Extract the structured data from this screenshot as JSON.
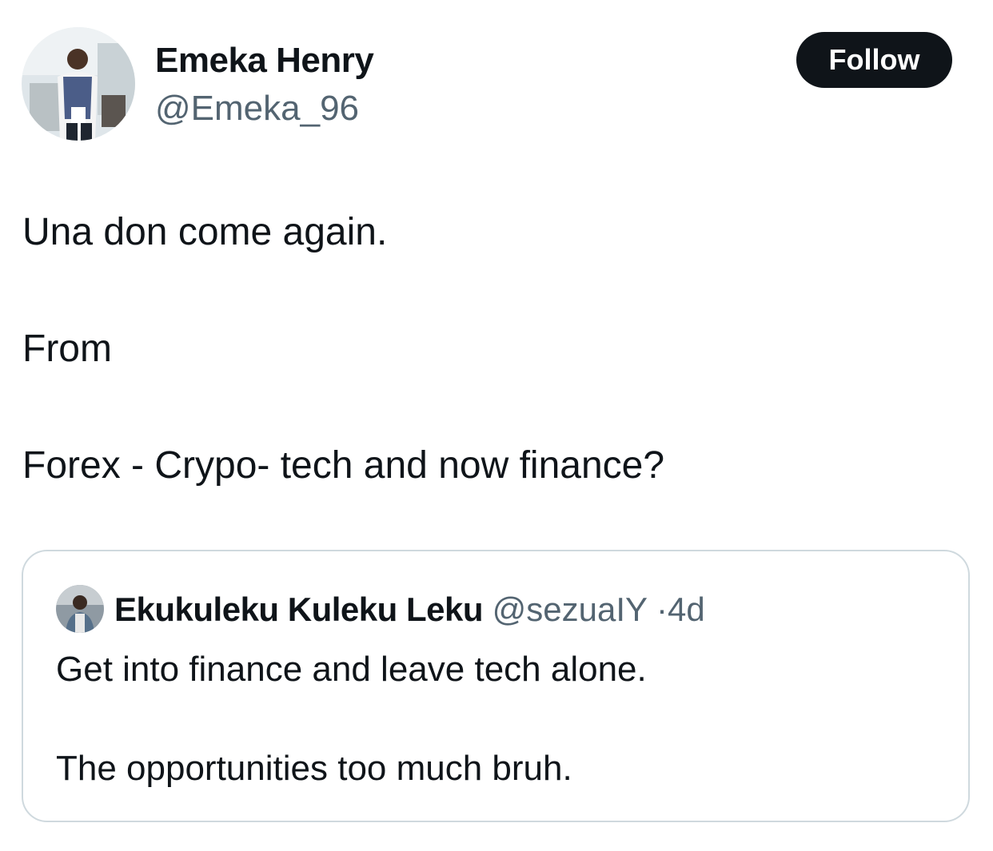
{
  "author": {
    "display_name": "Emeka Henry",
    "handle": "@Emeka_96",
    "avatar_icon": "profile-photo"
  },
  "follow_button": {
    "label": "Follow",
    "background": "#0f1419",
    "text_color": "#ffffff"
  },
  "tweet": {
    "lines": [
      "Una don come again.",
      "From",
      "Forex - Crypo- tech and now finance?"
    ]
  },
  "quoted_tweet": {
    "display_name": "Ekukuleku Kuleku Leku",
    "handle": "@sezuaIY",
    "separator": "·",
    "time": "4d",
    "avatar_icon": "profile-photo",
    "lines": [
      "Get into finance and leave tech alone.",
      "The opportunities too much bruh."
    ]
  },
  "colors": {
    "text_primary": "#0f1419",
    "text_secondary": "#536471",
    "border": "#cfd9de"
  }
}
